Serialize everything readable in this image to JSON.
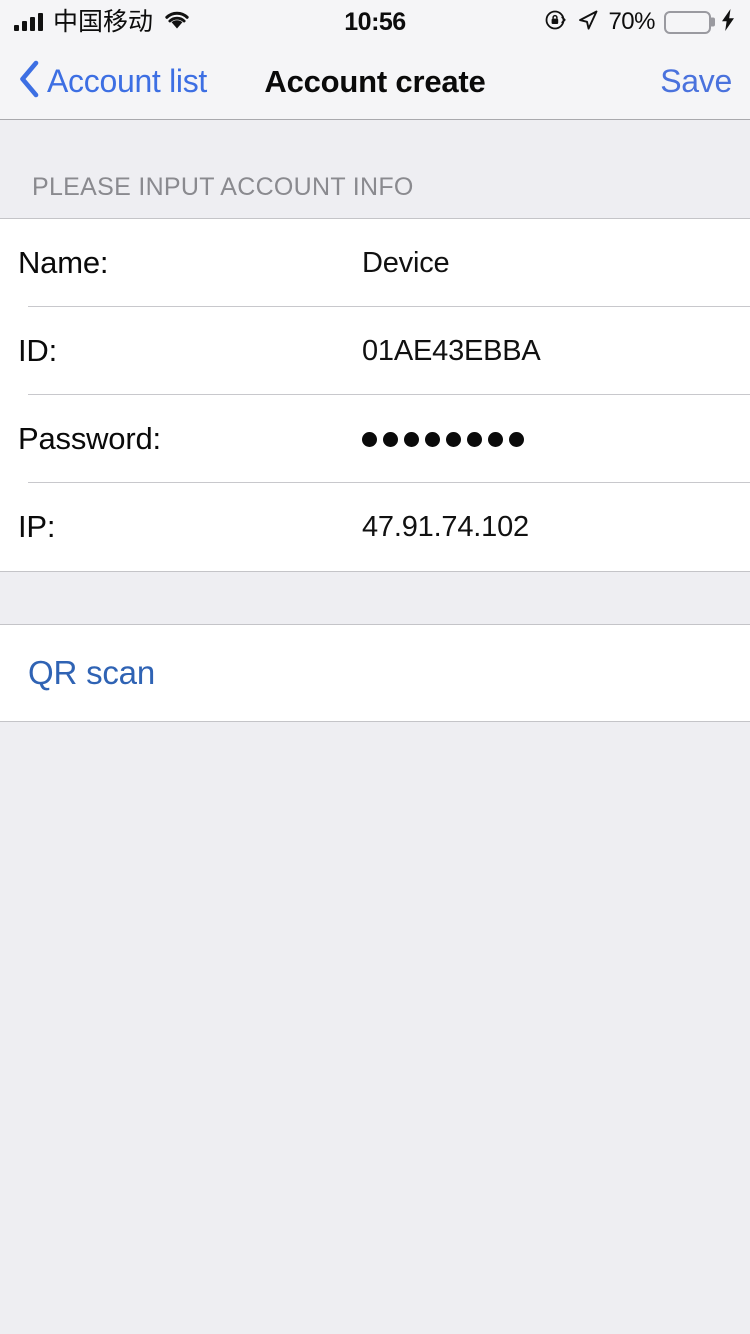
{
  "status_bar": {
    "carrier": "中国移动",
    "signal_icon": "signal-bars-icon",
    "wifi_icon": "wifi-icon",
    "time": "10:56",
    "rotation_lock_icon": "rotation-lock-icon",
    "location_icon": "location-arrow-icon",
    "battery_percent": "70%",
    "battery_level": 70,
    "battery_icon": "battery-icon",
    "charging_icon": "lightning-bolt-icon",
    "battery_color": "#6fd66f"
  },
  "nav_bar": {
    "back_icon": "chevron-left-icon",
    "back_label": "Account list",
    "title": "Account create",
    "save_label": "Save",
    "tint_color": "#3d6fe3"
  },
  "section": {
    "header": "PLEASE INPUT ACCOUNT INFO",
    "rows": [
      {
        "label": "Name:",
        "value": "Device",
        "type": "text"
      },
      {
        "label": "ID:",
        "value": "01AE43EBBA",
        "type": "text"
      },
      {
        "label": "Password:",
        "value": "••••••••",
        "type": "password",
        "dot_count": 8
      },
      {
        "label": "IP:",
        "value": "47.91.74.102",
        "type": "text"
      }
    ]
  },
  "actions": {
    "qr_scan_label": "QR scan",
    "link_color": "#2f63b4"
  }
}
